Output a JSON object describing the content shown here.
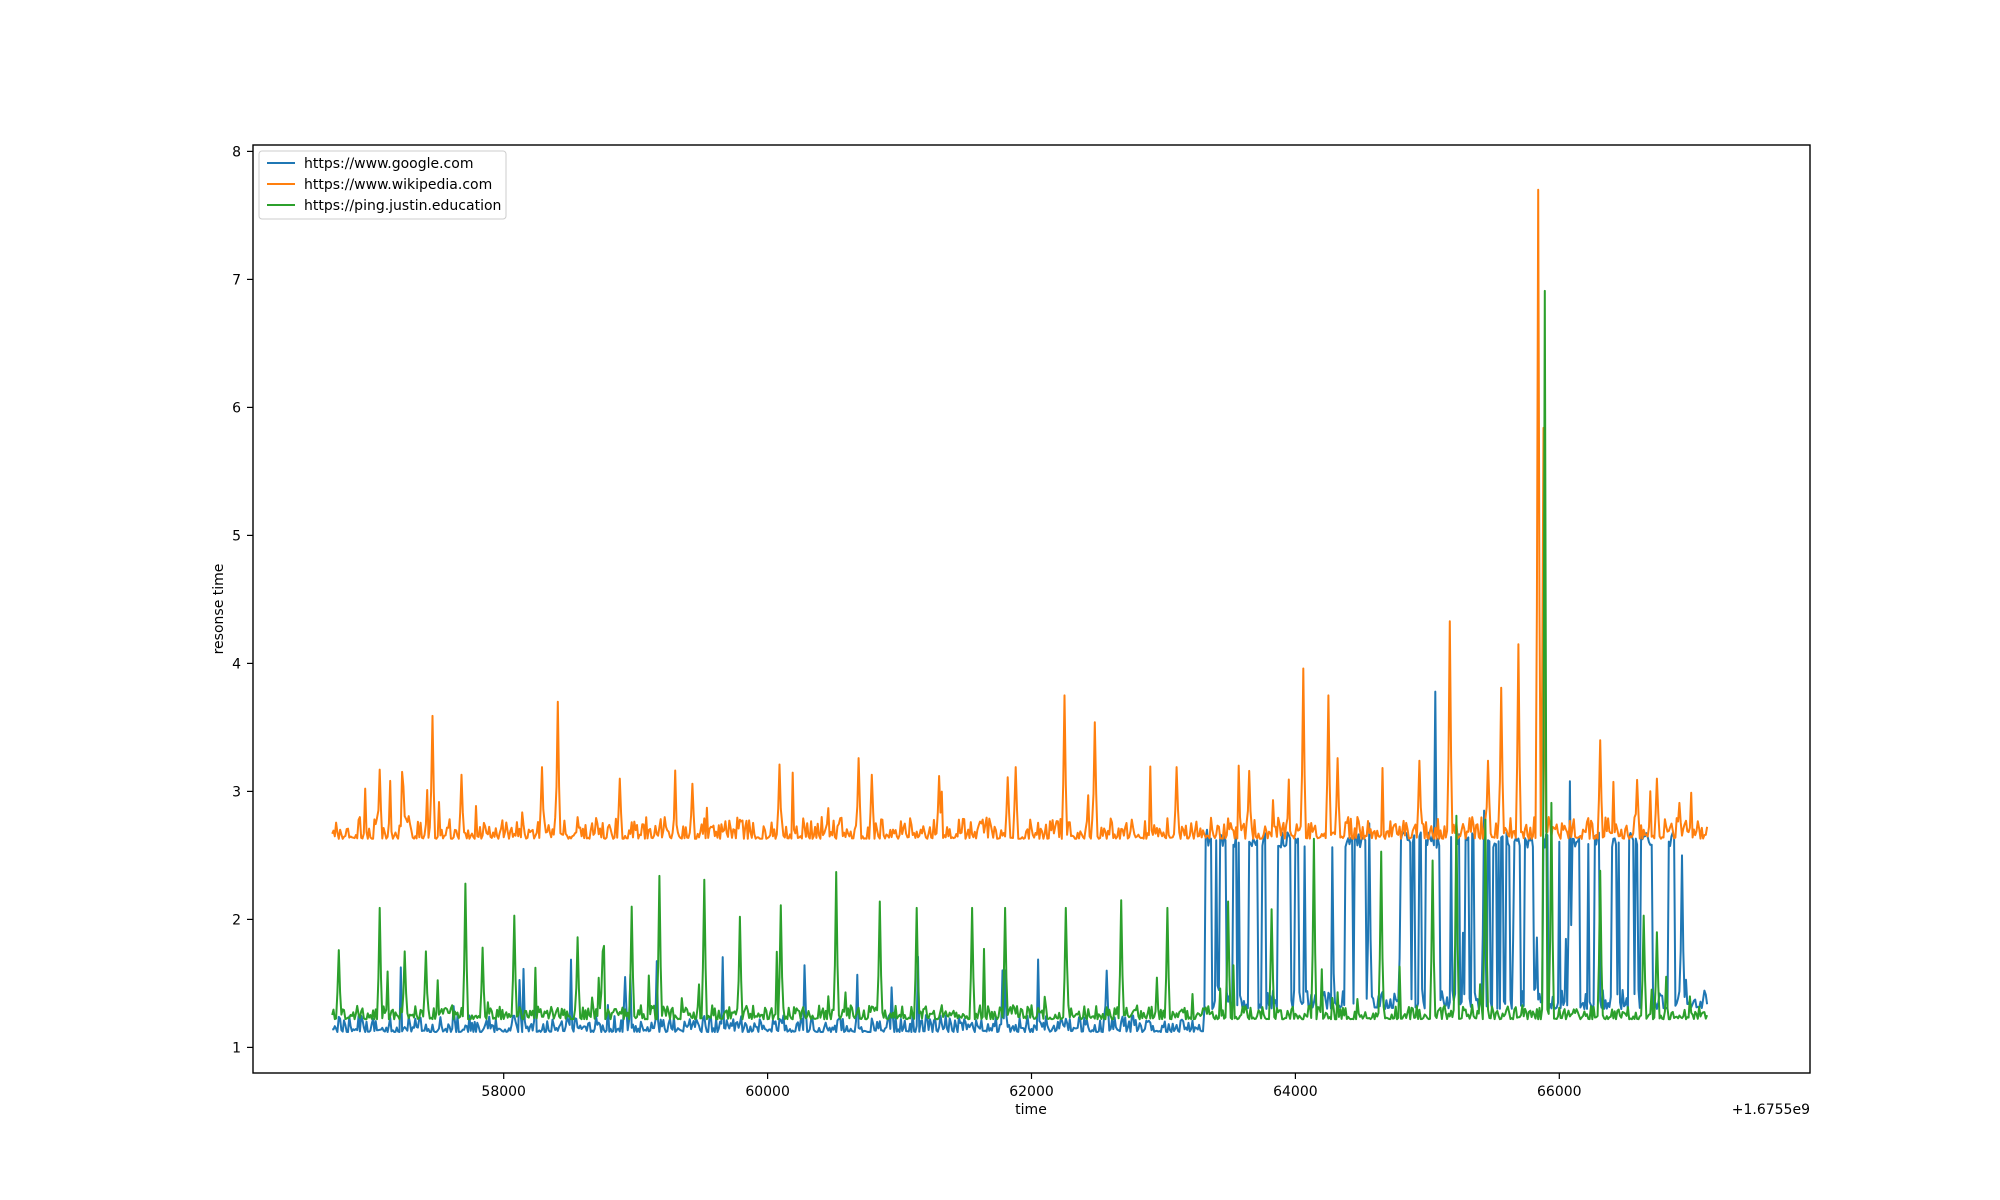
{
  "chart_data": {
    "type": "line",
    "title": "",
    "xlabel": "time",
    "ylabel": "resonse time",
    "x_offset_label": "+1.6755e9",
    "x_offset": 1675500000,
    "xlim": [
      56100,
      67900
    ],
    "ylim": [
      0.8,
      8.05
    ],
    "xticks": [
      58000,
      60000,
      62000,
      64000,
      66000
    ],
    "xtick_labels": [
      "58000",
      "60000",
      "62000",
      "64000",
      "66000"
    ],
    "yticks": [
      1,
      2,
      3,
      4,
      5,
      6,
      7,
      8
    ],
    "ytick_labels": [
      "1",
      "2",
      "3",
      "4",
      "5",
      "6",
      "7",
      "8"
    ],
    "grid": false,
    "legend_position": "upper-left",
    "x_range": [
      56700,
      67120
    ],
    "sample_step": 10,
    "series": [
      {
        "name": "https://www.google.com",
        "color": "#1f77b4",
        "segments": [
          {
            "x0": 56700,
            "x1": 63300,
            "base": 1.17,
            "noise": [
              1.12,
              1.25
            ]
          },
          {
            "x0": 63300,
            "x1": 67120,
            "base": 1.35,
            "noise": [
              1.3,
              1.45
            ],
            "bimodal_high": 2.68
          }
        ],
        "peaks": [
          {
            "x": 58920,
            "y": 1.55
          },
          {
            "x": 62570,
            "y": 1.6
          },
          {
            "x": 63330,
            "y": 2.7
          },
          {
            "x": 64560,
            "y": 2.75
          },
          {
            "x": 65060,
            "y": 3.78
          },
          {
            "x": 65430,
            "y": 2.85
          },
          {
            "x": 66080,
            "y": 3.08
          },
          {
            "x": 66650,
            "y": 2.65
          },
          {
            "x": 66930,
            "y": 2.5
          }
        ]
      },
      {
        "name": "https://www.wikipedia.com",
        "color": "#ff7f0e",
        "segments": [
          {
            "x0": 56700,
            "x1": 67120,
            "base": 2.68,
            "noise": [
              2.63,
              2.8
            ]
          }
        ],
        "peaks": [
          {
            "x": 57060,
            "y": 3.17
          },
          {
            "x": 57240,
            "y": 3.04
          },
          {
            "x": 57460,
            "y": 3.59
          },
          {
            "x": 57680,
            "y": 3.13
          },
          {
            "x": 58290,
            "y": 3.19
          },
          {
            "x": 58410,
            "y": 3.7
          },
          {
            "x": 58880,
            "y": 3.1
          },
          {
            "x": 59430,
            "y": 3.06
          },
          {
            "x": 60090,
            "y": 3.21
          },
          {
            "x": 60690,
            "y": 3.26
          },
          {
            "x": 60790,
            "y": 3.13
          },
          {
            "x": 61300,
            "y": 3.12
          },
          {
            "x": 61820,
            "y": 3.11
          },
          {
            "x": 61880,
            "y": 3.19
          },
          {
            "x": 62250,
            "y": 3.75
          },
          {
            "x": 62480,
            "y": 3.54
          },
          {
            "x": 63100,
            "y": 3.19
          },
          {
            "x": 63650,
            "y": 3.16
          },
          {
            "x": 64060,
            "y": 3.96
          },
          {
            "x": 64250,
            "y": 3.75
          },
          {
            "x": 64320,
            "y": 3.26
          },
          {
            "x": 64940,
            "y": 3.24
          },
          {
            "x": 65170,
            "y": 4.33
          },
          {
            "x": 65460,
            "y": 3.24
          },
          {
            "x": 65560,
            "y": 3.81
          },
          {
            "x": 65690,
            "y": 4.15
          },
          {
            "x": 65840,
            "y": 7.7
          },
          {
            "x": 65880,
            "y": 5.84
          },
          {
            "x": 66310,
            "y": 3.4
          },
          {
            "x": 66590,
            "y": 3.09
          },
          {
            "x": 66740,
            "y": 3.1
          },
          {
            "x": 66910,
            "y": 2.91
          }
        ]
      },
      {
        "name": "https://ping.justin.education",
        "color": "#2ca02c",
        "segments": [
          {
            "x0": 56700,
            "x1": 67120,
            "base": 1.25,
            "noise": [
              1.22,
              1.33
            ]
          }
        ],
        "peaks": [
          {
            "x": 56750,
            "y": 1.76
          },
          {
            "x": 57060,
            "y": 2.09
          },
          {
            "x": 57250,
            "y": 1.75
          },
          {
            "x": 57410,
            "y": 1.75
          },
          {
            "x": 57710,
            "y": 2.28
          },
          {
            "x": 57840,
            "y": 1.78
          },
          {
            "x": 58080,
            "y": 2.03
          },
          {
            "x": 58560,
            "y": 1.86
          },
          {
            "x": 58750,
            "y": 1.75
          },
          {
            "x": 58970,
            "y": 2.1
          },
          {
            "x": 59180,
            "y": 2.34
          },
          {
            "x": 59520,
            "y": 2.31
          },
          {
            "x": 59790,
            "y": 2.02
          },
          {
            "x": 60100,
            "y": 2.11
          },
          {
            "x": 60520,
            "y": 2.37
          },
          {
            "x": 60850,
            "y": 2.14
          },
          {
            "x": 61130,
            "y": 2.09
          },
          {
            "x": 61550,
            "y": 2.09
          },
          {
            "x": 61800,
            "y": 2.09
          },
          {
            "x": 62260,
            "y": 2.09
          },
          {
            "x": 62680,
            "y": 2.15
          },
          {
            "x": 63030,
            "y": 2.09
          },
          {
            "x": 63490,
            "y": 2.14
          },
          {
            "x": 63820,
            "y": 2.08
          },
          {
            "x": 64140,
            "y": 2.63
          },
          {
            "x": 64650,
            "y": 2.53
          },
          {
            "x": 65040,
            "y": 2.46
          },
          {
            "x": 65220,
            "y": 2.81
          },
          {
            "x": 65440,
            "y": 2.78
          },
          {
            "x": 65890,
            "y": 6.91
          },
          {
            "x": 65940,
            "y": 2.91
          },
          {
            "x": 66310,
            "y": 2.38
          },
          {
            "x": 66640,
            "y": 2.03
          },
          {
            "x": 66740,
            "y": 1.9
          }
        ]
      }
    ]
  }
}
